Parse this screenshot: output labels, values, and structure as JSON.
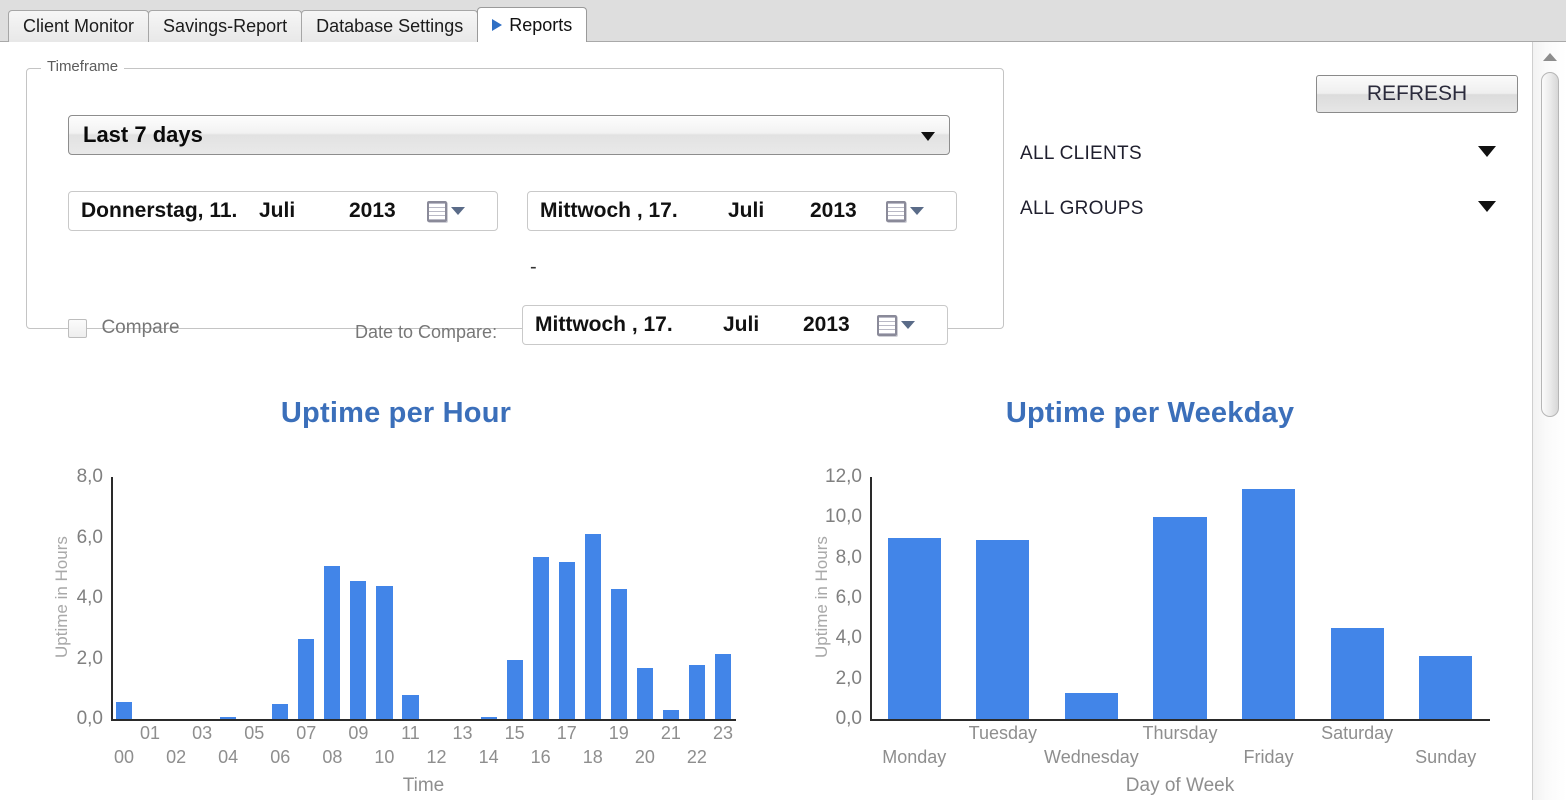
{
  "tabs": [
    {
      "label": "Client Monitor",
      "active": false
    },
    {
      "label": "Savings-Report",
      "active": false
    },
    {
      "label": "Database Settings",
      "active": false
    },
    {
      "label": "Reports",
      "active": true,
      "icon": "play-triangle-icon"
    }
  ],
  "timeframe": {
    "group_title": "Timeframe",
    "range_select": {
      "value": "Last 7 days",
      "icon": "chevron-down-icon"
    },
    "start_date": {
      "weekday_day": "Donnerstag, 11.",
      "month": "Juli",
      "year": "2013",
      "icon": "calendar-icon"
    },
    "separator": "-",
    "end_date": {
      "weekday_day": "Mittwoch  , 17.",
      "month": "Juli",
      "year": "2013",
      "icon": "calendar-icon"
    },
    "compare": {
      "checkbox_label": "Compare",
      "checked": false
    },
    "date_to_compare": {
      "label": "Date to Compare:",
      "weekday_day": "Mittwoch  , 17.",
      "month": "Juli",
      "year": "2013",
      "icon": "calendar-icon"
    }
  },
  "toolbar": {
    "refresh_label": "REFRESH",
    "clients_filter": "ALL CLIENTS",
    "groups_filter": "ALL GROUPS"
  },
  "colors": {
    "bar": "#4285e8",
    "title": "#3b6fba",
    "axis": "#2a2a2a",
    "tick_text": "#8e8e8e"
  },
  "chart_data": [
    {
      "type": "bar",
      "title": "Uptime per Hour",
      "xlabel": "Time",
      "ylabel": "Uptime in Hours",
      "ylim": [
        0,
        8
      ],
      "yticks": [
        "0,0",
        "2,0",
        "4,0",
        "6,0",
        "8,0"
      ],
      "ytick_values": [
        0,
        2,
        4,
        6,
        8
      ],
      "grid": false,
      "legend": "none",
      "categories": [
        "00",
        "01",
        "02",
        "03",
        "04",
        "05",
        "06",
        "07",
        "08",
        "09",
        "10",
        "11",
        "12",
        "13",
        "14",
        "15",
        "16",
        "17",
        "18",
        "19",
        "20",
        "21",
        "22",
        "23"
      ],
      "values": [
        0.55,
        0.0,
        0.0,
        0.0,
        0.07,
        0.0,
        0.48,
        2.65,
        5.05,
        4.55,
        4.4,
        0.8,
        0.0,
        0.0,
        0.07,
        1.95,
        5.35,
        5.2,
        6.1,
        4.3,
        1.7,
        0.3,
        1.8,
        2.15
      ]
    },
    {
      "type": "bar",
      "title": "Uptime per Weekday",
      "xlabel": "Day of Week",
      "ylabel": "Uptime in Hours",
      "ylim": [
        0,
        12
      ],
      "yticks": [
        "0,0",
        "2,0",
        "4,0",
        "6,0",
        "8,0",
        "10,0",
        "12,0"
      ],
      "ytick_values": [
        0,
        2,
        4,
        6,
        8,
        10,
        12
      ],
      "grid": false,
      "legend": "none",
      "categories": [
        "Monday",
        "Tuesday",
        "Wednesday",
        "Thursday",
        "Friday",
        "Saturday",
        "Sunday"
      ],
      "values": [
        9.0,
        8.9,
        1.3,
        10.0,
        11.4,
        4.5,
        3.1
      ]
    }
  ]
}
